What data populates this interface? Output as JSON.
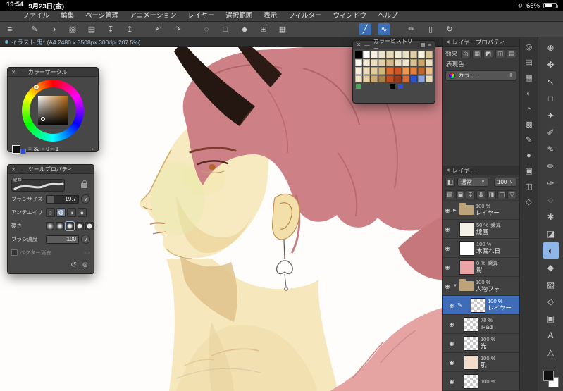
{
  "status_bar": {
    "time": "19:54",
    "date": "9月23日(金)",
    "battery_percent": "65%"
  },
  "menu_bar": {
    "items": [
      "ファイル",
      "編集",
      "ページ管理",
      "アニメーション",
      "レイヤー",
      "選択範囲",
      "表示",
      "フィルター",
      "ウィンドウ",
      "ヘルプ"
    ]
  },
  "toolbar": {
    "icons": [
      {
        "dn": "main-menu-icon",
        "glyph": "≡"
      },
      {
        "dn": "pen-quick-icon",
        "glyph": "✎"
      },
      {
        "dn": "brush-quick-icon",
        "glyph": "◑"
      },
      {
        "dn": "tone-icon",
        "glyph": "▨"
      },
      {
        "dn": "new-canvas-icon",
        "glyph": "▤"
      },
      {
        "dn": "save-icon",
        "glyph": "↧"
      },
      {
        "dn": "export-icon",
        "glyph": "↥"
      },
      {
        "dn": "undo-icon",
        "glyph": "↶"
      },
      {
        "dn": "redo-icon",
        "glyph": "↷"
      },
      {
        "dn": "deselect-icon",
        "glyph": "◌"
      },
      {
        "dn": "select-area-icon",
        "glyph": "□"
      },
      {
        "dn": "fill-icon",
        "glyph": "◆"
      },
      {
        "dn": "transform-icon",
        "glyph": "⊞"
      },
      {
        "dn": "grid-snap-icon",
        "glyph": "▦"
      },
      {
        "dn": "straight-line-icon",
        "glyph": "╱",
        "active": true
      },
      {
        "dn": "curve-line-icon",
        "glyph": "∿",
        "active": true
      },
      {
        "dn": "pencil-quick-icon",
        "glyph": "✏"
      },
      {
        "dn": "device-icon",
        "glyph": "▯"
      },
      {
        "dn": "reset-view-icon",
        "glyph": "↻"
      }
    ]
  },
  "tab_bar": {
    "active_tab": "イラスト 鬼* (A4 2480 x 3508px 300dpi 207.5%)"
  },
  "icons": {
    "close": "✕",
    "minimize": "—",
    "eye": "◉",
    "pencil": "✎",
    "panel_arrow": "◀",
    "updown": "⇕",
    "down": "∨",
    "clock": "◔",
    "bars": "≡",
    "small_sq": "▫",
    "reset": "↺",
    "settings": "⊛",
    "rotation": "↻",
    "clip": "◧",
    "grid": "▦",
    "menu": "≡",
    "chev_right": "›"
  },
  "panels": {
    "color_circle": {
      "title": "カラーサークル",
      "values": [
        "32",
        "0",
        "1"
      ]
    },
    "tool_property": {
      "title": "ツールプロパティ",
      "brush_name": "硬め",
      "size_label": "ブラシサイズ",
      "size_value": "19.7",
      "aa_label": "アンチエイリ",
      "aa_options": [
        {
          "glyph": "○"
        },
        {
          "glyph": "◍",
          "active": true
        },
        {
          "glyph": "◑"
        },
        {
          "glyph": "●"
        }
      ],
      "hardness_label": "硬さ",
      "density_label": "ブラシ濃度",
      "density_value": "100",
      "vector_erase_label": "ベクター消去",
      "vector_icons": [
        {
          "dn": "vector-erase-option-icon",
          "glyph": "▫"
        },
        {
          "dn": "vector-erase-option-icon",
          "glyph": "▫"
        }
      ]
    },
    "color_history": {
      "title": "カラーヒストリー",
      "swatches": [
        "#000000",
        "#ffffff",
        "#f6efdf",
        "#efe5cc",
        "#e7d8ba",
        "#f2ebd8",
        "#ece1c6",
        "#dfcda6",
        "#f8f2e3",
        "#d8c59a",
        "#fdf8ee",
        "#f4ebd7",
        "#ecdfc2",
        "#e2d0a9",
        "#d2ba88",
        "#e9dcbf",
        "#f1e8d2",
        "#d7c190",
        "#c7a767",
        "#eee1c5",
        "#f6eeda",
        "#ecdebb",
        "#e0cb9a",
        "#d0b478",
        "#df6a2e",
        "#d3541e",
        "#ee994d",
        "#e48039",
        "#c1682d",
        "#eebf88",
        "#f2e5c6",
        "#e5d1a2",
        "#cead72",
        "#a88149",
        "#c14d21",
        "#9b3919",
        "#d76934",
        "#2e54d3",
        "#8ea2df",
        "#e7d8b7"
      ],
      "indicators": [
        "#3fae52",
        "#000000",
        "#2c4fd8"
      ]
    },
    "layer_property": {
      "title": "レイヤープロパティ",
      "effect_label": "効果",
      "effect_icons": [
        {
          "dn": "border-effect-icon",
          "glyph": "◎"
        },
        {
          "dn": "tone-effect-icon",
          "glyph": "▦"
        },
        {
          "dn": "layer-color-effect-icon",
          "glyph": "◩"
        },
        {
          "dn": "duplicate-panel-icon",
          "glyph": "◫"
        },
        {
          "dn": "list-view-icon",
          "glyph": "▤"
        }
      ],
      "expression_label": "表現色",
      "expression_value": "カラー"
    },
    "layer": {
      "title": "レイヤー",
      "blend_mode": "通常",
      "opacity": "100",
      "control_icons": [
        {
          "dn": "new-raster-layer-icon",
          "glyph": "▤"
        },
        {
          "dn": "new-layer-folder-icon",
          "glyph": "▣"
        },
        {
          "dn": "transfer-down-icon",
          "glyph": "↧"
        },
        {
          "dn": "merge-down-icon",
          "glyph": "⇊"
        },
        {
          "dn": "layer-mask-icon",
          "glyph": "◨"
        },
        {
          "dn": "divide-view-icon",
          "glyph": "◫"
        },
        {
          "dn": "delete-layer-icon",
          "glyph": "▽"
        }
      ],
      "layers": [
        {
          "dn": "layer-row-folder-top",
          "opacity": "100 %",
          "blend": "",
          "name": "レイヤー",
          "kind": "folder",
          "arrow": "▶"
        },
        {
          "dn": "layer-row-senga",
          "opacity": "50 %",
          "blend": "乗算",
          "name": "線画",
          "arrow": "",
          "thumb": "#f4f0e8"
        },
        {
          "dn": "layer-row-komorebi",
          "opacity": "100 %",
          "blend": "",
          "name": "木漏れ日",
          "arrow": "",
          "thumb": "#ffffff"
        },
        {
          "dn": "layer-row-kage",
          "opacity": "0 %",
          "blend": "乗算",
          "name": "影",
          "arrow": "",
          "thumb": "#eba3a6"
        },
        {
          "dn": "layer-row-jinbutsu-folder",
          "opacity": "100 %",
          "blend": "",
          "name": "人物フォ",
          "kind": "folder",
          "arrow": "▼"
        },
        {
          "dn": "layer-row-selected",
          "opacity": "100 %",
          "blend": "",
          "name": "レイヤー",
          "arrow": "",
          "selected": true,
          "indent": true
        },
        {
          "dn": "layer-row-ipad",
          "opacity": "78 %",
          "blend": "",
          "name": "iPad",
          "arrow": "",
          "indent": true
        },
        {
          "dn": "layer-row-hikari",
          "opacity": "100 %",
          "blend": "",
          "name": "光",
          "arrow": "",
          "indent": true
        },
        {
          "dn": "layer-row-hada",
          "opacity": "100 %",
          "blend": "",
          "name": "肌",
          "arrow": "",
          "indent": true,
          "thumb": "#f3dcc9"
        },
        {
          "dn": "layer-row-bottom",
          "opacity": "100 %",
          "blend": "",
          "name": "",
          "arrow": "",
          "indent": true
        }
      ]
    }
  },
  "panel_tabs": [
    {
      "dn": "color-circle-tab-icon",
      "glyph": "◎"
    },
    {
      "dn": "color-slider-tab-icon",
      "glyph": "▤"
    },
    {
      "dn": "color-set-tab-icon",
      "glyph": "▦"
    },
    {
      "dn": "color-mixer-tab-icon",
      "glyph": "◐"
    },
    {
      "dn": "color-history-tab-icon",
      "glyph": "◔"
    },
    {
      "dn": "swatch-tab-icon",
      "glyph": "▩"
    },
    {
      "dn": "tool-property-tab-icon",
      "glyph": "✎"
    },
    {
      "dn": "brush-size-tab-icon",
      "glyph": "●"
    },
    {
      "dn": "sub-view-tab-icon",
      "glyph": "▣"
    },
    {
      "dn": "material-tab-icon",
      "glyph": "◫"
    },
    {
      "dn": "navigator-tab-icon",
      "glyph": "◇"
    }
  ],
  "tools": [
    {
      "dn": "zoom-tool-icon",
      "glyph": "⊕"
    },
    {
      "dn": "move-canvas-tool-icon",
      "glyph": "✥"
    },
    {
      "dn": "operation-tool-icon",
      "glyph": "↖"
    },
    {
      "dn": "selection-tool-icon",
      "glyph": "□"
    },
    {
      "dn": "auto-select-tool-icon",
      "glyph": "✦"
    },
    {
      "dn": "eyedropper-tool-icon",
      "glyph": "✐"
    },
    {
      "dn": "pen-tool-icon",
      "glyph": "✎"
    },
    {
      "dn": "pencil-tool-icon",
      "glyph": "✏"
    },
    {
      "dn": "brush-tool-icon",
      "glyph": "✑"
    },
    {
      "dn": "airbrush-tool-icon",
      "glyph": "◌"
    },
    {
      "dn": "decoration-tool-icon",
      "glyph": "✱"
    },
    {
      "dn": "eraser-tool-icon",
      "glyph": "◪"
    },
    {
      "dn": "blend-tool-icon",
      "glyph": "◐",
      "active": true
    },
    {
      "dn": "fill-tool-icon",
      "glyph": "◆"
    },
    {
      "dn": "gradient-tool-icon",
      "glyph": "▧"
    },
    {
      "dn": "figure-tool-icon",
      "glyph": "◇"
    },
    {
      "dn": "frame-border-tool-icon",
      "glyph": "▣"
    },
    {
      "dn": "text-tool-icon",
      "glyph": "A"
    },
    {
      "dn": "ruler-tool-icon",
      "glyph": "△"
    }
  ],
  "colors": {
    "selection_blue": "#3e6cb8",
    "active_tool_blue": "#8fb6e8",
    "panel_bg": "#474747",
    "canvas_white": "#ffffff"
  }
}
